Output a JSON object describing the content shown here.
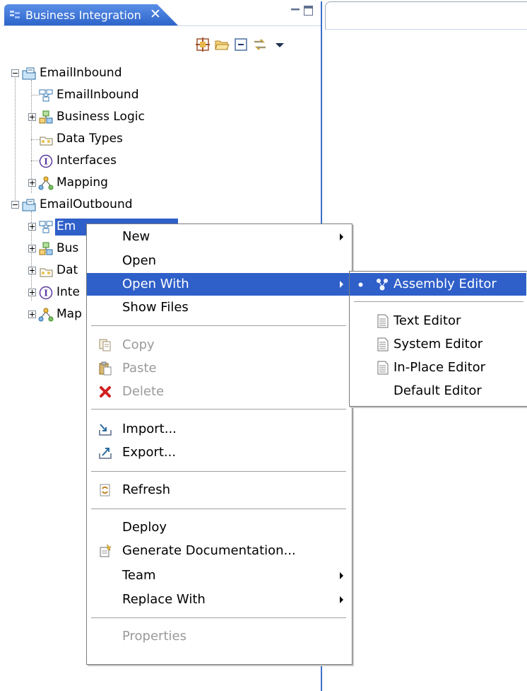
{
  "view": {
    "tab_label": "Business Integration",
    "close_glyph": "✕",
    "toolbar_icons": [
      "filter-icon",
      "open-folder-icon",
      "collapse-all-icon",
      "link-with-editor-icon",
      "view-menu-icon"
    ]
  },
  "tree": {
    "items": [
      {
        "label": "EmailInbound",
        "level": 0,
        "toggle": "minus",
        "icon": "project-icon"
      },
      {
        "label": "EmailInbound",
        "level": 1,
        "toggle": "none",
        "icon": "assembly-icon"
      },
      {
        "label": "Business Logic",
        "level": 1,
        "toggle": "plus",
        "icon": "business-logic-icon"
      },
      {
        "label": "Data Types",
        "level": 1,
        "toggle": "none",
        "icon": "data-types-icon"
      },
      {
        "label": "Interfaces",
        "level": 1,
        "toggle": "none",
        "icon": "interfaces-icon"
      },
      {
        "label": "Mapping",
        "level": 1,
        "toggle": "plus",
        "icon": "mapping-icon"
      },
      {
        "label": "EmailOutbound",
        "level": 0,
        "toggle": "minus",
        "icon": "project-icon"
      },
      {
        "label": "Em",
        "level": 1,
        "toggle": "plus",
        "icon": "assembly-icon",
        "selected": true
      },
      {
        "label": "Bus",
        "level": 1,
        "toggle": "plus",
        "icon": "business-logic-icon"
      },
      {
        "label": "Dat",
        "level": 1,
        "toggle": "plus",
        "icon": "data-types-icon"
      },
      {
        "label": "Inte",
        "level": 1,
        "toggle": "plus",
        "icon": "interfaces-icon"
      },
      {
        "label": "Map",
        "level": 1,
        "toggle": "plus",
        "icon": "mapping-icon"
      }
    ]
  },
  "context_menu": {
    "items": [
      {
        "label": "New",
        "submenu": true
      },
      {
        "label": "Open"
      },
      {
        "label": "Open With",
        "submenu": true,
        "highlighted": true
      },
      {
        "label": "Show Files"
      },
      {
        "label": "Copy",
        "disabled": true,
        "icon": "copy-icon"
      },
      {
        "label": "Paste",
        "disabled": true,
        "icon": "paste-icon"
      },
      {
        "label": "Delete",
        "disabled": true,
        "icon": "delete-icon"
      },
      {
        "label": "Import...",
        "icon": "import-icon"
      },
      {
        "label": "Export...",
        "icon": "export-icon"
      },
      {
        "label": "Refresh",
        "icon": "refresh-icon"
      },
      {
        "label": "Deploy"
      },
      {
        "label": "Generate Documentation...",
        "icon": "generate-docs-icon"
      },
      {
        "label": "Team",
        "submenu": true
      },
      {
        "label": "Replace With",
        "submenu": true
      },
      {
        "label": "Properties",
        "disabled": true
      }
    ]
  },
  "submenu": {
    "items": [
      {
        "label": "Assembly Editor",
        "icon": "assembly-editor-icon",
        "checked": true,
        "highlighted": true
      },
      {
        "label": "Text Editor",
        "icon": "text-file-icon"
      },
      {
        "label": "System Editor",
        "icon": "text-file-icon"
      },
      {
        "label": "In-Place Editor",
        "icon": "text-file-icon"
      },
      {
        "label": "Default Editor"
      }
    ]
  },
  "colors": {
    "selection": "#2f5fc9",
    "tab_gradient_top": "#5b8fe8",
    "disabled_text": "#9a9a9a"
  }
}
